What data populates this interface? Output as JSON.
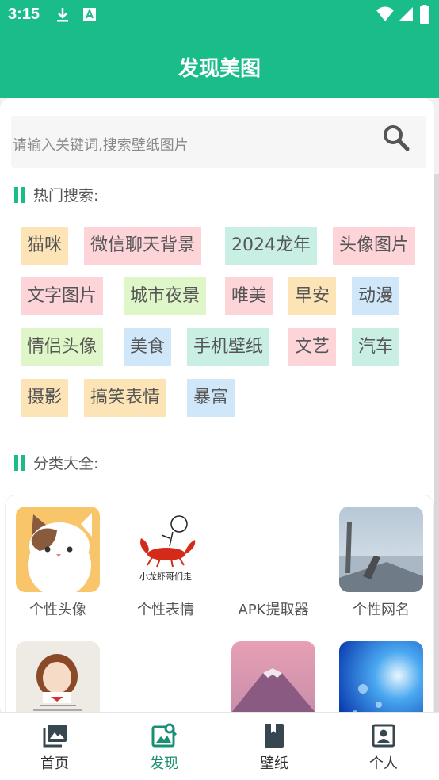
{
  "status_bar": {
    "time": "3:15"
  },
  "app_bar": {
    "title": "发现美图"
  },
  "search": {
    "placeholder": "请输入关键词,搜索壁纸图片"
  },
  "hot_search": {
    "heading": "热门搜索:",
    "tags": [
      {
        "label": "猫咪",
        "color": "#fde4b6"
      },
      {
        "label": "微信聊天背景",
        "color": "#fdd5d9"
      },
      {
        "label": "2024龙年",
        "color": "#c9efe4"
      },
      {
        "label": "头像图片",
        "color": "#fdd5d9"
      },
      {
        "label": "文字图片",
        "color": "#fdd5d9"
      },
      {
        "label": "城市夜景",
        "color": "#dff7c8"
      },
      {
        "label": "唯美",
        "color": "#fdd5d9"
      },
      {
        "label": "早安",
        "color": "#fde4b6"
      },
      {
        "label": "动漫",
        "color": "#cfe7f8"
      },
      {
        "label": "情侣头像",
        "color": "#dff7c8"
      },
      {
        "label": "美食",
        "color": "#cfe7f8"
      },
      {
        "label": "手机壁纸",
        "color": "#c9efe4"
      },
      {
        "label": "文艺",
        "color": "#fdd5d9"
      },
      {
        "label": "汽车",
        "color": "#c9efe4"
      },
      {
        "label": "摄影",
        "color": "#fde4b6"
      },
      {
        "label": "搞笑表情",
        "color": "#fde4b6"
      },
      {
        "label": "暴富",
        "color": "#cfe7f8"
      }
    ]
  },
  "categories": {
    "heading": "分类大全:",
    "items": [
      {
        "label": "个性头像",
        "icon": "cartoon-cat-avatar"
      },
      {
        "label": "个性表情",
        "icon": "crayfish-sticker",
        "sticker_text": "小龙虾哥们走"
      },
      {
        "label": "APK提取器",
        "icon": "none"
      },
      {
        "label": "个性网名",
        "icon": "seaside-photo"
      },
      {
        "label": "",
        "icon": "girl-illustration"
      },
      {
        "label": "",
        "icon": "none"
      },
      {
        "label": "",
        "icon": "mountain-photo"
      },
      {
        "label": "",
        "icon": "blue-sparkle-photo"
      }
    ]
  },
  "bottom_nav": {
    "items": [
      {
        "label": "首页",
        "icon": "gallery-icon",
        "active": false
      },
      {
        "label": "发现",
        "icon": "image-search-icon",
        "active": true
      },
      {
        "label": "壁纸",
        "icon": "bookmark-book-icon",
        "active": false
      },
      {
        "label": "个人",
        "icon": "account-box-icon",
        "active": false
      }
    ]
  },
  "colors": {
    "accent": "#1abd8a",
    "active_nav": "#1a8f74"
  }
}
